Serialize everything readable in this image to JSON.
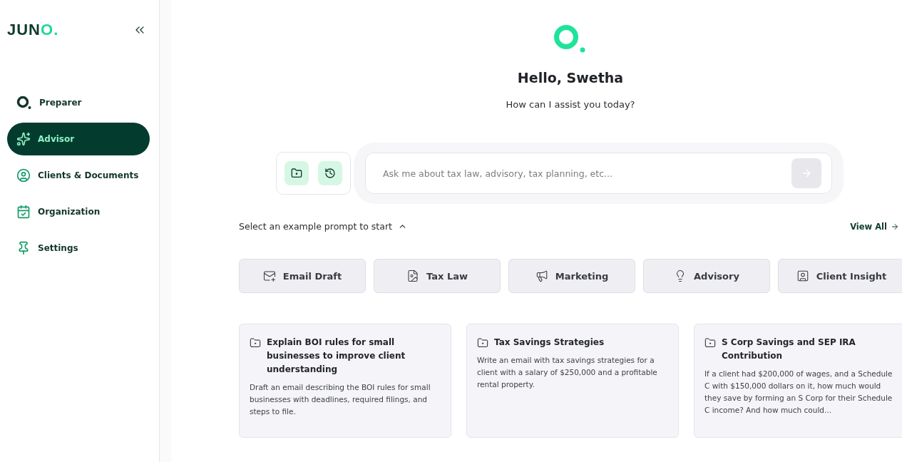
{
  "sidebar": {
    "logo": {
      "text": "JUN",
      "accent": "O."
    },
    "items": [
      {
        "label": "Preparer",
        "kind": "preparer",
        "selected": false
      },
      {
        "label": "Advisor",
        "kind": "advisor",
        "selected": true
      },
      {
        "label": "Clients & Documents",
        "kind": "clients",
        "selected": false
      },
      {
        "label": "Organization",
        "kind": "organization",
        "selected": false
      },
      {
        "label": "Settings",
        "kind": "settings",
        "selected": false
      }
    ]
  },
  "hero": {
    "greeting": "Hello, Swetha",
    "subtitle": "How can I assist you today?"
  },
  "composer": {
    "placeholder": "Ask me about tax law, advisory, tax planning, etc...",
    "tools": [
      {
        "kind": "folder"
      },
      {
        "kind": "history"
      }
    ]
  },
  "prompts": {
    "heading": "Select an example prompt to start",
    "view_all": "View All",
    "categories": [
      {
        "label": "Email Draft",
        "kind": "email"
      },
      {
        "label": "Tax Law",
        "kind": "law"
      },
      {
        "label": "Marketing",
        "kind": "marketing"
      },
      {
        "label": "Advisory",
        "kind": "advisory"
      },
      {
        "label": "Client Insight",
        "kind": "insight"
      }
    ],
    "cards": [
      {
        "title": "Explain BOI rules for small businesses to improve client understanding",
        "body": "Draft an email describing the BOI rules for small businesses with deadlines, required filings, and steps to file."
      },
      {
        "title": "Tax Savings Strategies",
        "body": "Write an email with tax savings strategies for a client with a salary of $250,000 and a profitable rental property."
      },
      {
        "title": "S Corp Savings and SEP IRA Contribution",
        "body": "If a client had $200,000 of wages, and a Schedule C with $150,000 dollars on it, how much would they save by forming an S Corp for their Schedule C income? And how much could..."
      }
    ]
  }
}
